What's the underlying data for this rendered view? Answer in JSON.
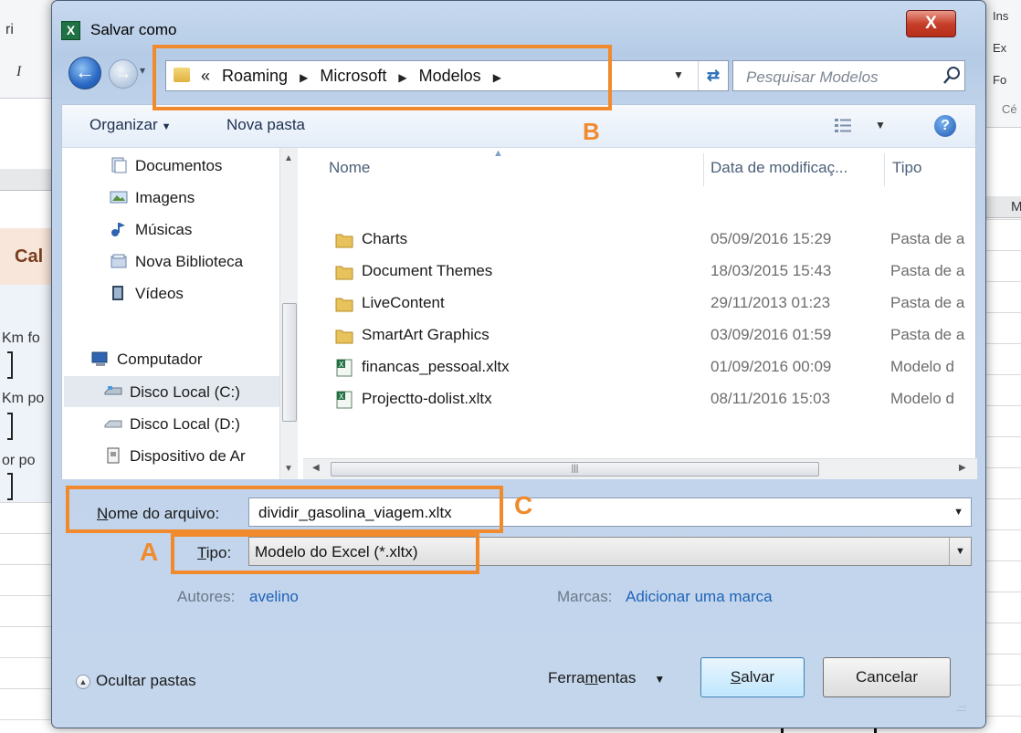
{
  "background": {
    "left_texts": [
      "ri",
      "I",
      "Cal",
      "Km fo",
      "Km po",
      "or po"
    ],
    "right_texts": [
      "Ins",
      "Ex",
      "Fo",
      "Cé",
      "M"
    ]
  },
  "dialog": {
    "title": "Salvar como",
    "close_label": "X",
    "address": {
      "overflow_marker": "«",
      "crumbs": [
        "Roaming",
        "Microsoft",
        "Modelos"
      ]
    },
    "search_placeholder": "Pesquisar Modelos",
    "toolbar": {
      "organize": "Organizar",
      "new_folder": "Nova pasta"
    },
    "nav": [
      {
        "label": "Documentos",
        "icon": "documents-library-icon"
      },
      {
        "label": "Imagens",
        "icon": "pictures-library-icon"
      },
      {
        "label": "Músicas",
        "icon": "music-library-icon"
      },
      {
        "label": "Nova Biblioteca",
        "icon": "library-icon"
      },
      {
        "label": "Vídeos",
        "icon": "videos-library-icon"
      },
      {
        "label": "Computador",
        "icon": "computer-icon"
      },
      {
        "label": "Disco Local (C:)",
        "icon": "drive-c-icon"
      },
      {
        "label": "Disco Local (D:)",
        "icon": "drive-d-icon"
      },
      {
        "label": "Dispositivo de Ar",
        "icon": "storage-device-icon"
      }
    ],
    "columns": {
      "name": "Nome",
      "date": "Data de modificaç...",
      "type": "Tipo"
    },
    "files": [
      {
        "name": "Charts",
        "date": "05/09/2016 15:29",
        "type": "Pasta de a",
        "icon": "folder-icon"
      },
      {
        "name": "Document Themes",
        "date": "18/03/2015 15:43",
        "type": "Pasta de a",
        "icon": "folder-icon"
      },
      {
        "name": "LiveContent",
        "date": "29/11/2013 01:23",
        "type": "Pasta de a",
        "icon": "folder-icon"
      },
      {
        "name": "SmartArt Graphics",
        "date": "03/09/2016 01:59",
        "type": "Pasta de a",
        "icon": "folder-icon"
      },
      {
        "name": "financas_pessoal.xltx",
        "date": "01/09/2016 00:09",
        "type": "Modelo d",
        "icon": "excel-template-icon"
      },
      {
        "name": "Projectto-dolist.xltx",
        "date": "08/11/2016 15:03",
        "type": "Modelo d",
        "icon": "excel-template-icon"
      }
    ],
    "form": {
      "filename_label_u": "N",
      "filename_label_rest": "ome do arquivo:",
      "filename_value": "dividir_gasolina_viagem.xltx",
      "type_label_u": "T",
      "type_label_rest": "ipo:",
      "type_value": "Modelo do Excel (*.xltx)",
      "authors_label": "Autores:",
      "authors_value": "avelino",
      "tags_label": "Marcas:",
      "tags_value": "Adicionar uma marca"
    },
    "footer": {
      "hide_folders": "Ocultar pastas",
      "tools_pre": "Ferra",
      "tools_u": "m",
      "tools_post": "entas",
      "save_u": "S",
      "save_rest": "alvar",
      "cancel": "Cancelar"
    },
    "annotations": {
      "a": "A",
      "b": "B",
      "c": "C"
    },
    "annotation_color": "#f08a2d"
  }
}
